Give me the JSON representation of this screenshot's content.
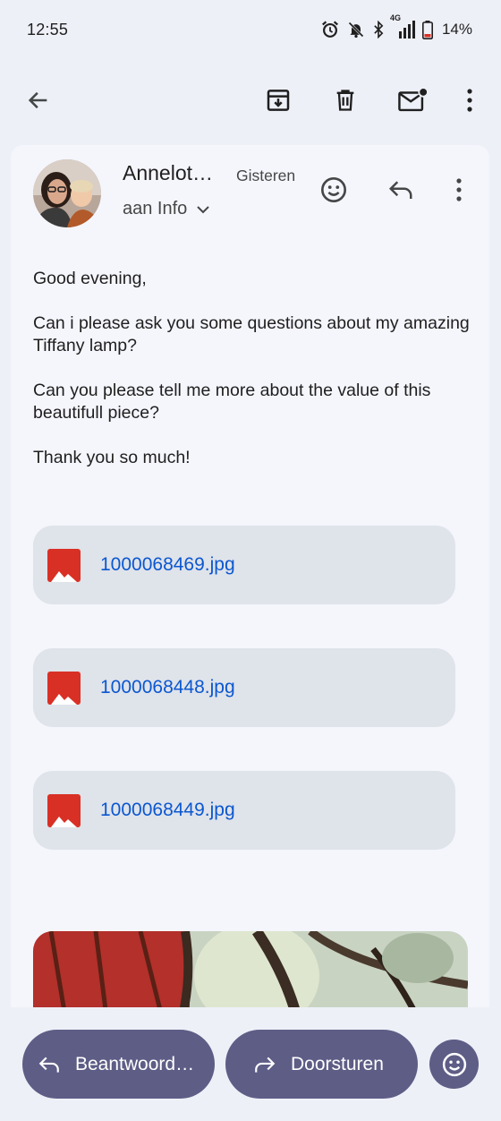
{
  "status_bar": {
    "time": "12:55",
    "network": "4G",
    "battery_percent": "14%"
  },
  "toolbar": {
    "icons": [
      "back-arrow-icon",
      "archive-icon",
      "delete-icon",
      "mark-unread-icon",
      "more-vert-icon"
    ]
  },
  "email": {
    "sender_name": "Annelot…",
    "date": "Gisteren",
    "recipient": "aan Info",
    "body": [
      "Good evening,",
      "Can i please ask you some questions about my amazing Tiffany lamp?",
      "Can you please tell me more about the value of this beautifull piece?",
      "Thank you so much!"
    ]
  },
  "attachments": [
    {
      "name": "1000068469.jpg"
    },
    {
      "name": "1000068448.jpg"
    },
    {
      "name": "1000068449.jpg"
    }
  ],
  "actions": {
    "reply_label": "Beantwoord…",
    "forward_label": "Doorsturen"
  },
  "colors": {
    "background": "#eef0f8",
    "card": "#f5f6fc",
    "attachment_chip": "#dfe3ea",
    "attachment_link": "#0b57d0",
    "image_icon": "#d93025",
    "action_pill": "#5e5d86",
    "battery_low": "#d93025"
  }
}
